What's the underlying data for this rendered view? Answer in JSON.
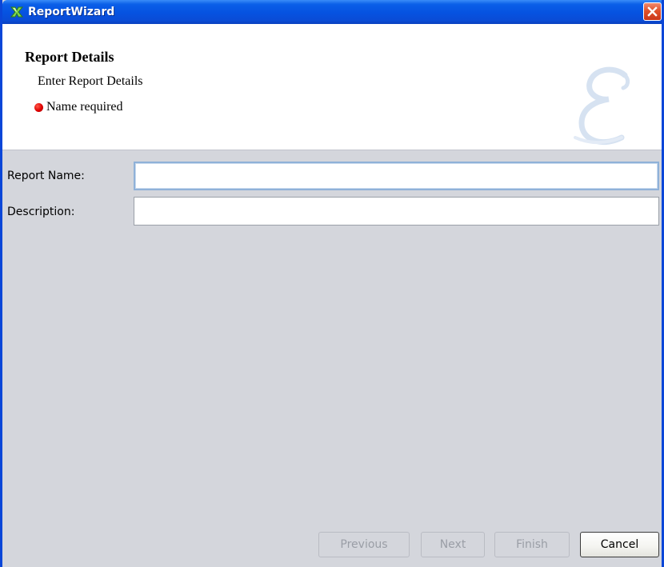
{
  "window": {
    "title": "ReportWizard",
    "title_icon": "wizard-app-icon",
    "close_icon": "close-icon"
  },
  "header": {
    "title": "Report Details",
    "subtitle": "Enter Report Details",
    "error_message": "Name required",
    "error_icon": "red-dot-error-icon",
    "watermark_icon": "script-e-watermark-icon"
  },
  "form": {
    "report_name": {
      "label": "Report Name:",
      "value": "",
      "placeholder": ""
    },
    "description": {
      "label": "Description:",
      "value": "",
      "placeholder": ""
    }
  },
  "buttons": {
    "previous": {
      "label": "Previous",
      "enabled": false
    },
    "next": {
      "label": "Next",
      "enabled": false
    },
    "finish": {
      "label": "Finish",
      "enabled": false
    },
    "cancel": {
      "label": "Cancel",
      "enabled": true
    }
  },
  "colors": {
    "titlebar": "#0652e0",
    "close_button": "#e0512a",
    "error_dot": "#e00000",
    "panel_background": "#d4d6dc",
    "focus_border": "#8fb1d8"
  }
}
